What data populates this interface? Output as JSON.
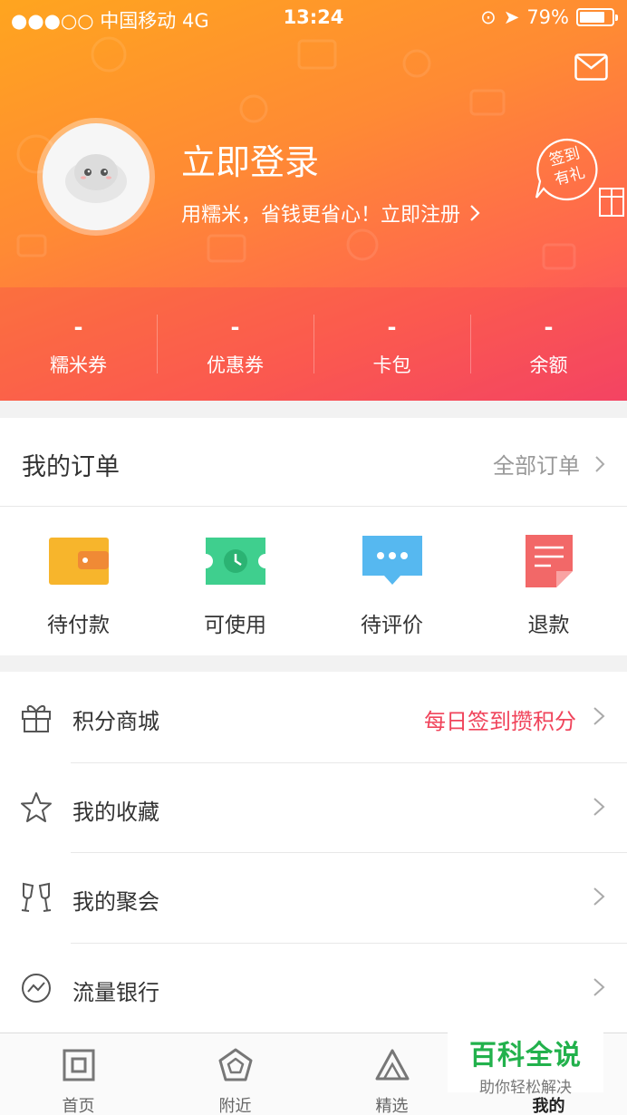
{
  "status_bar": {
    "signal": "●●●○○ 中国移动  4G",
    "time": "13:24",
    "battery": "79%",
    "battery_fraction": 0.79
  },
  "header": {
    "login_title": "立即登录",
    "login_subtitle": "用糯米，省钱更省心！立即注册",
    "checkin_badge_line1": "签到",
    "checkin_badge_line2": "有礼"
  },
  "stats": [
    {
      "value": "-",
      "label": "糯米券"
    },
    {
      "value": "-",
      "label": "优惠券"
    },
    {
      "value": "-",
      "label": "卡包"
    },
    {
      "value": "-",
      "label": "余额"
    }
  ],
  "orders": {
    "title": "我的订单",
    "all_label": "全部订单",
    "items": [
      {
        "label": "待付款",
        "icon": "wallet-icon",
        "color": "#f7b52c"
      },
      {
        "label": "可使用",
        "icon": "ticket-clock-icon",
        "color": "#3fcf8e"
      },
      {
        "label": "待评价",
        "icon": "chat-bubble-icon",
        "color": "#56b8f0"
      },
      {
        "label": "退款",
        "icon": "refund-note-icon",
        "color": "#f26868"
      }
    ]
  },
  "menu": [
    {
      "label": "积分商城",
      "extra": "每日签到攒积分",
      "icon": "gift-icon"
    },
    {
      "label": "我的收藏",
      "extra": "",
      "icon": "star-icon"
    },
    {
      "label": "我的聚会",
      "extra": "",
      "icon": "glasses-cheers-icon"
    },
    {
      "label": "流量银行",
      "extra": "",
      "icon": "trend-circle-icon"
    }
  ],
  "tabbar": [
    {
      "label": "首页",
      "icon": "home-square-icon"
    },
    {
      "label": "附近",
      "icon": "nearby-pentagon-icon"
    },
    {
      "label": "精选",
      "icon": "featured-triangle-icon"
    },
    {
      "label": "我的",
      "icon": "profile-icon",
      "active": true
    }
  ],
  "watermark": {
    "line1": "百科全说",
    "line2": "助你轻松解决"
  },
  "colors": {
    "accent": "#ff7a3a",
    "badge_red": "#f0445b"
  }
}
